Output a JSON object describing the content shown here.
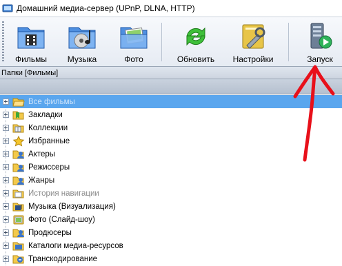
{
  "window": {
    "title": "Домашний медиа-сервер (UPnP, DLNA, HTTP)"
  },
  "toolbar": {
    "buttons": [
      {
        "label": "Фильмы",
        "icon": "films-folder-icon"
      },
      {
        "label": "Музыка",
        "icon": "music-folder-icon"
      },
      {
        "label": "Фото",
        "icon": "photo-folder-icon"
      },
      {
        "label": "Обновить",
        "icon": "refresh-icon"
      },
      {
        "label": "Настройки",
        "icon": "settings-icon"
      },
      {
        "label": "Запуск",
        "icon": "launch-server-icon"
      }
    ]
  },
  "panel": {
    "header": "Папки [Фильмы]"
  },
  "tree": {
    "items": [
      {
        "label": "Все фильмы",
        "icon": "folder-open-icon",
        "selected": true,
        "dim": true
      },
      {
        "label": "Закладки",
        "icon": "bookmarks-icon"
      },
      {
        "label": "Коллекции",
        "icon": "collections-icon"
      },
      {
        "label": "Избранные",
        "icon": "star-icon"
      },
      {
        "label": "Актеры",
        "icon": "actors-icon"
      },
      {
        "label": "Режиссеры",
        "icon": "directors-icon"
      },
      {
        "label": "Жанры",
        "icon": "genres-icon"
      },
      {
        "label": "История навигации",
        "icon": "history-icon",
        "dim": true
      },
      {
        "label": "Музыка (Визуализация)",
        "icon": "music-visual-icon"
      },
      {
        "label": "Фото (Слайд-шоу)",
        "icon": "slideshow-icon"
      },
      {
        "label": "Продюсеры",
        "icon": "producers-icon"
      },
      {
        "label": "Каталоги медиа-ресурсов",
        "icon": "catalogs-icon"
      },
      {
        "label": "Транскодирование",
        "icon": "transcoding-icon"
      }
    ]
  },
  "colors": {
    "selection": "#5aa6ee",
    "annotation_arrow": "#e8101a"
  }
}
